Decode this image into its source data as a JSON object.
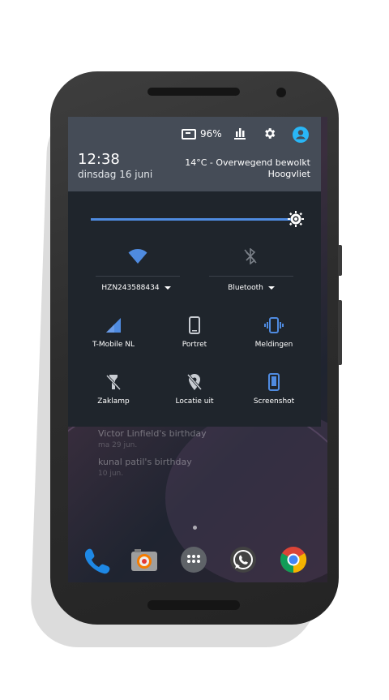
{
  "status": {
    "battery_percent": "96%",
    "icons": [
      "battery-icon",
      "bar-chart-icon",
      "settings-icon",
      "account-icon"
    ],
    "accent_color": "#29b6f6"
  },
  "header": {
    "time": "12:38",
    "date": "dinsdag 16 juni",
    "weather_line1": "14°C - Overwegend bewolkt",
    "weather_line2": "Hoogvliet"
  },
  "quick_settings": {
    "brightness_level": 1.0,
    "wifi": {
      "label": "HZN243588434",
      "icon": "wifi-icon"
    },
    "bluetooth": {
      "label": "Bluetooth",
      "icon": "bluetooth-off-icon"
    },
    "tiles": [
      {
        "label": "T-Mobile NL",
        "icon": "signal-icon"
      },
      {
        "label": "Portret",
        "icon": "phone-portrait-icon"
      },
      {
        "label": "Meldingen",
        "icon": "vibrate-icon"
      },
      {
        "label": "Zaklamp",
        "icon": "flashlight-off-icon"
      },
      {
        "label": "Locatie uit",
        "icon": "location-off-icon"
      },
      {
        "label": "Screenshot",
        "icon": "screenshot-icon"
      }
    ]
  },
  "home": {
    "events": [
      {
        "title": "Victor Linfield's birthday",
        "date": "ma 29 jun."
      },
      {
        "title": "kunal patil's birthday",
        "date": "10 jun."
      }
    ],
    "dock": [
      "phone-app-icon",
      "camera-app-icon",
      "app-drawer-icon",
      "whatsapp-icon",
      "chrome-icon"
    ]
  }
}
